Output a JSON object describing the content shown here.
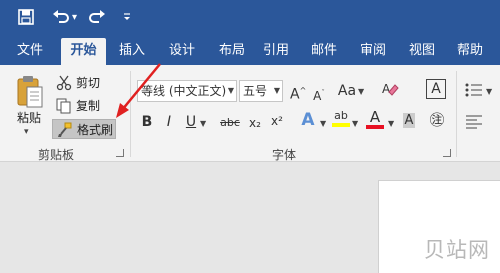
{
  "quick_access": {
    "save_icon": "save-icon",
    "undo_icon": "undo-icon",
    "undo_dropdown": "▾",
    "redo_icon": "redo-icon",
    "customize_icon": "customize-icon"
  },
  "tabs": [
    {
      "label": "文件",
      "active": false
    },
    {
      "label": "开始",
      "active": true
    },
    {
      "label": "插入",
      "active": false
    },
    {
      "label": "设计",
      "active": false
    },
    {
      "label": "布局",
      "active": false
    },
    {
      "label": "引用",
      "active": false
    },
    {
      "label": "邮件",
      "active": false
    },
    {
      "label": "审阅",
      "active": false
    },
    {
      "label": "视图",
      "active": false
    },
    {
      "label": "帮助",
      "active": false
    }
  ],
  "clipboard": {
    "paste_label": "粘贴",
    "paste_dropdown": "▾",
    "cut_label": "剪切",
    "copy_label": "复制",
    "format_painter_label": "格式刷",
    "group_label": "剪贴板"
  },
  "font": {
    "font_name": "等线 (中文正文)",
    "font_size": "五号",
    "grow": "A",
    "shrink": "A",
    "change_case": "Aa",
    "bold": "B",
    "italic": "I",
    "underline": "U",
    "strikethrough": "abc",
    "subscript": "x₂",
    "superscript": "x²",
    "text_effect": "A",
    "highlight": "ab",
    "font_color": "A",
    "enclose": "㊟",
    "group_label": "字体"
  },
  "watermark": "贝站网",
  "colors": {
    "brand": "#2b579a",
    "highlight_yellow": "#ffff00",
    "font_color_red": "#e81123",
    "arrow_red": "#e02020"
  }
}
